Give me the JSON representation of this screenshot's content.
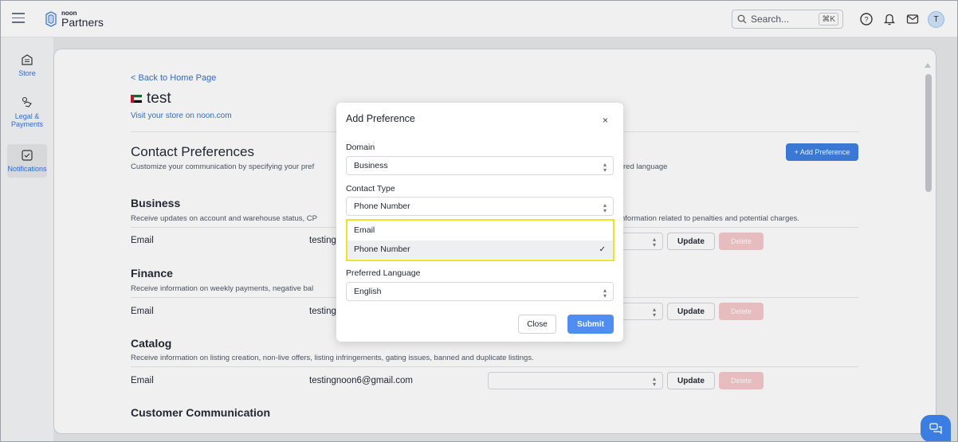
{
  "topbar": {
    "logo_small": "noon",
    "logo_big": "Partners",
    "search_placeholder": "Search...",
    "shortcut": "⌘K",
    "avatar_initial": "T"
  },
  "sidebar": {
    "items": [
      {
        "label": "Store",
        "icon": "store-icon"
      },
      {
        "label": "Legal & Payments",
        "icon": "legal-payments-icon"
      },
      {
        "label": "Notifications",
        "icon": "notifications-icon"
      }
    ]
  },
  "page": {
    "back_link": "< Back to Home Page",
    "store_name": "test",
    "visit_link": "Visit your store on noon.com",
    "cp_title": "Contact Preferences",
    "cp_desc_left": "Customize your communication by specifying your pref",
    "cp_desc_right": "red language",
    "add_pref_button": "+ Add Preference",
    "sections": [
      {
        "title": "Business",
        "desc_left": "Receive updates on account and warehouse status, CP",
        "desc_right": "nformation related to penalties and potential charges.",
        "row_type": "Email",
        "row_value": "testing",
        "update": "Update",
        "delete": "Delete"
      },
      {
        "title": "Finance",
        "desc_left": "Receive information on weekly payments, negative bal",
        "row_type": "Email",
        "row_value": "testing",
        "update": "Update",
        "delete": "Delete"
      },
      {
        "title": "Catalog",
        "desc_left": "Receive information on listing creation, non-live offers, listing infringements, gating issues, banned and duplicate listings.",
        "row_type": "Email",
        "row_value": "testingnoon6@gmail.com",
        "update": "Update",
        "delete": "Delete"
      },
      {
        "title": "Customer Communication"
      }
    ]
  },
  "modal": {
    "title": "Add Preference",
    "close_icon": "×",
    "domain_label": "Domain",
    "domain_value": "Business",
    "contact_type_label": "Contact Type",
    "contact_type_value": "Phone Number",
    "options": [
      "Email",
      "Phone Number"
    ],
    "selected_check": "✓",
    "language_label": "Preferred Language",
    "language_value": "English",
    "close_button": "Close",
    "submit_button": "Submit"
  },
  "colors": {
    "accent": "#3b7de0",
    "delete": "#f6c7c9",
    "highlight": "#f0e12b"
  }
}
